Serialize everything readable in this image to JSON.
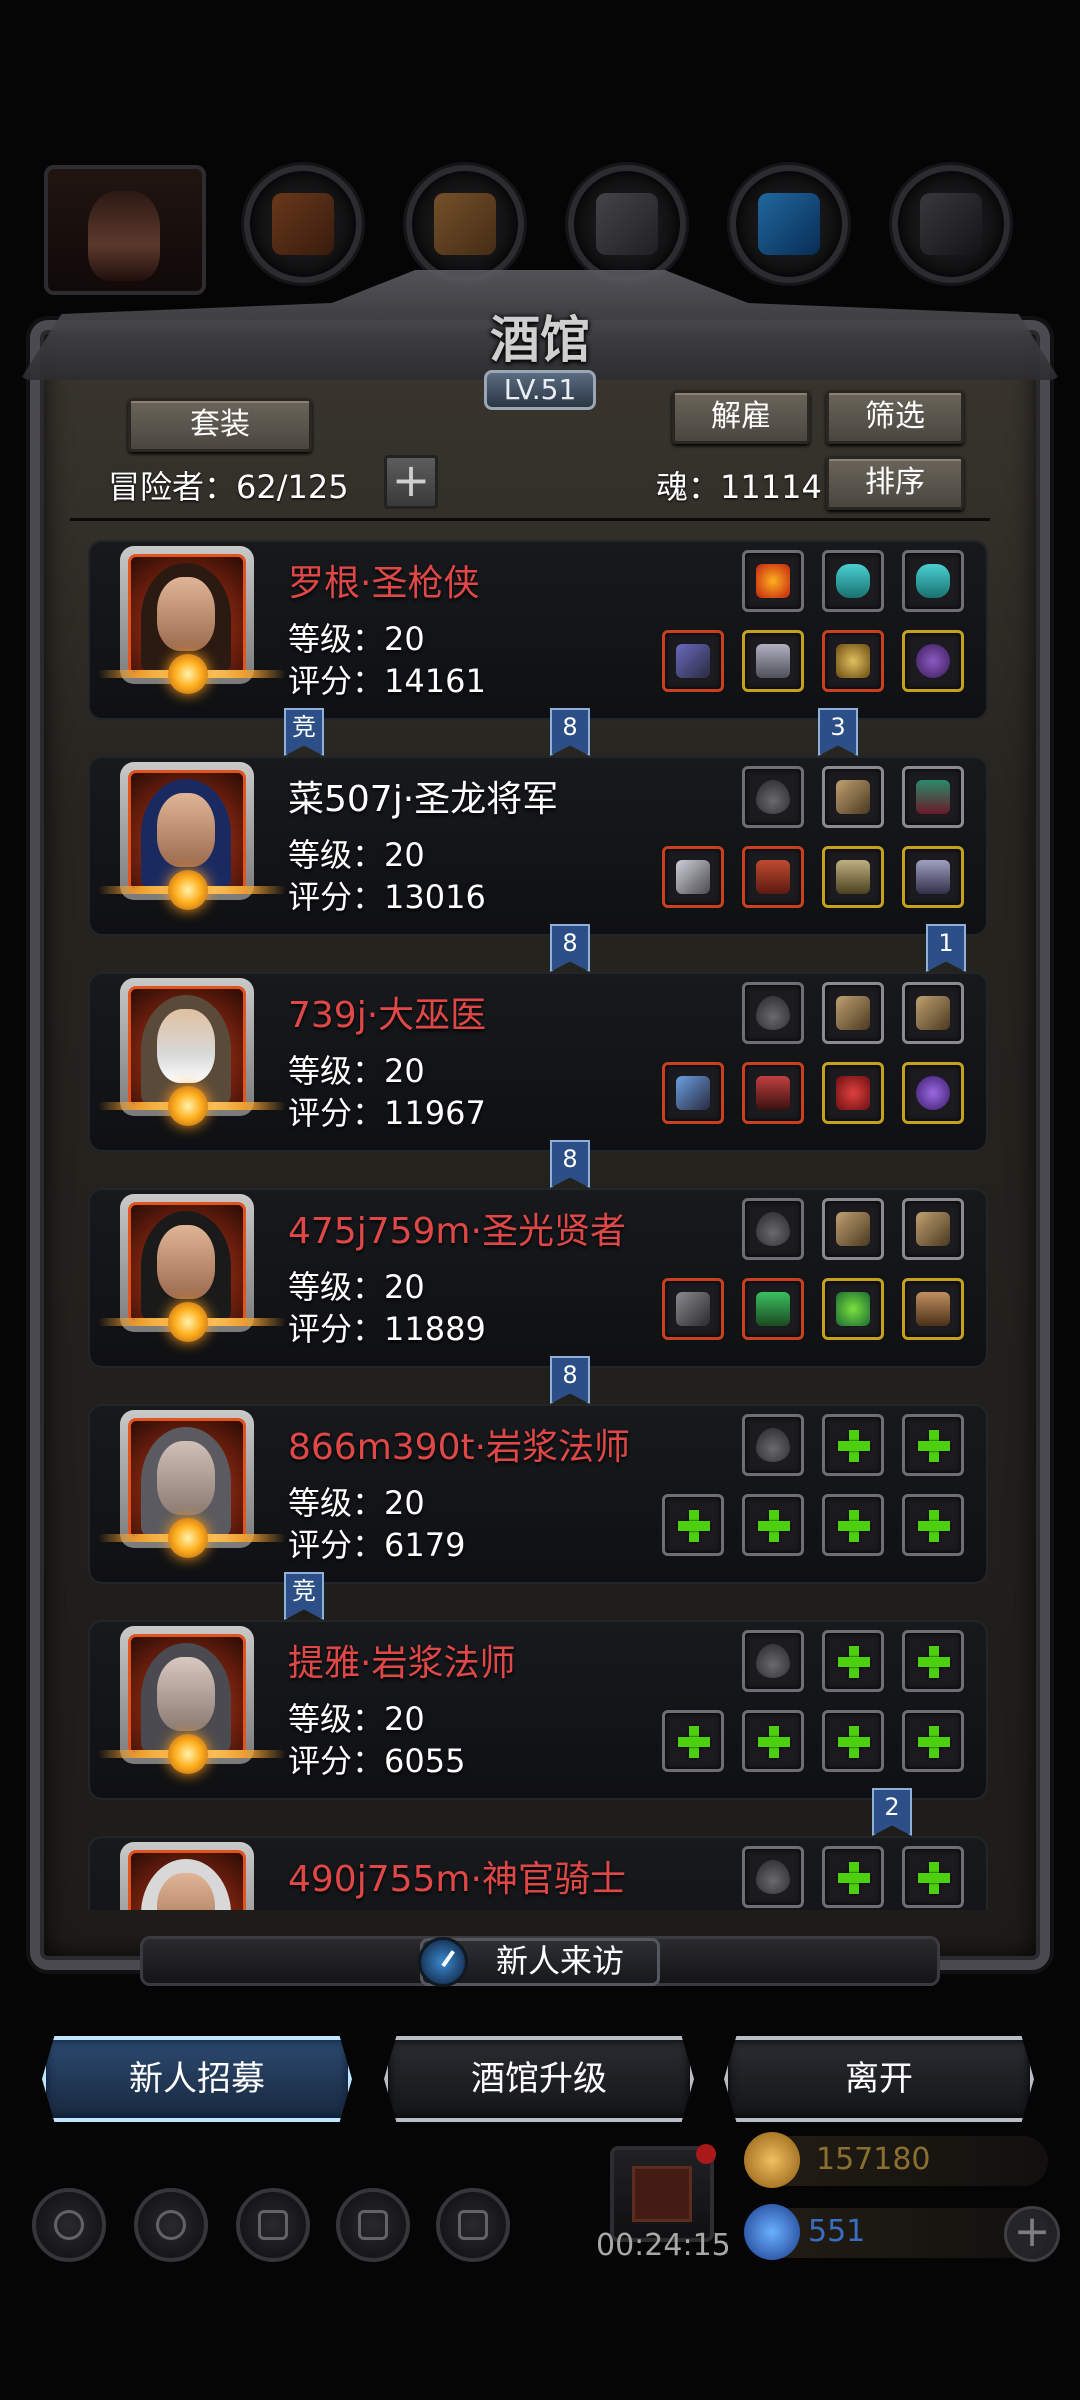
{
  "header": {
    "title": "酒馆",
    "level": "LV.51"
  },
  "controls": {
    "set_label": "套装",
    "dismiss_label": "解雇",
    "filter_label": "筛选",
    "sort_label": "排序",
    "adventurers_text": "冒险者：62/125",
    "soul_text": "魂：11114",
    "add_symbol": "+"
  },
  "heroes": [
    {
      "name": "罗根·圣枪侠",
      "name_color": "red",
      "level": "等级：20",
      "score": "评分：14161"
    },
    {
      "name": "菜507j·圣龙将军",
      "name_color": "white",
      "level": "等级：20",
      "score": "评分：13016"
    },
    {
      "name": "739j·大巫医",
      "name_color": "red",
      "level": "等级：20",
      "score": "评分：11967"
    },
    {
      "name": "475j759m·圣光贤者",
      "name_color": "red",
      "level": "等级：20",
      "score": "评分：11889"
    },
    {
      "name": "866m390t·岩浆法师",
      "name_color": "red",
      "level": "等级：20",
      "score": "评分：6179"
    },
    {
      "name": "提雅·岩浆法师",
      "name_color": "red",
      "level": "等级：20",
      "score": "评分：6055"
    },
    {
      "name": "490j755m·神官骑士",
      "name_color": "red",
      "level": "",
      "score": ""
    }
  ],
  "ribbons": {
    "r1_left": "竞",
    "r1_mid": "8",
    "r1_right": "3",
    "r2_mid": "8",
    "r2_right": "1",
    "r3_mid": "8",
    "r4_mid": "8",
    "r5_left": "竞",
    "r6_right": "2"
  },
  "bottom": {
    "visitor_label": "新人来访",
    "recruit_label": "新人招募",
    "upgrade_label": "酒馆升级",
    "leave_label": "离开",
    "timer": "00:24:15",
    "gold": "157180",
    "gems": "551",
    "plus_symbol": "+"
  },
  "icons": [
    "clock-icon",
    "gift-icon",
    "gold-coin-icon",
    "gem-icon",
    "plus-icon",
    "settings-icon",
    "star-icon",
    "shop-icon",
    "mail-icon",
    "bag-icon"
  ],
  "colors": {
    "hero_name_red": "#e04848",
    "add_slot_green": "#4cd010",
    "ribbon_blue": "#2b4f86",
    "gold_text": "#8a7030",
    "gem_text": "#3a6cc0",
    "active_button_glow": "#6fc8ff"
  }
}
